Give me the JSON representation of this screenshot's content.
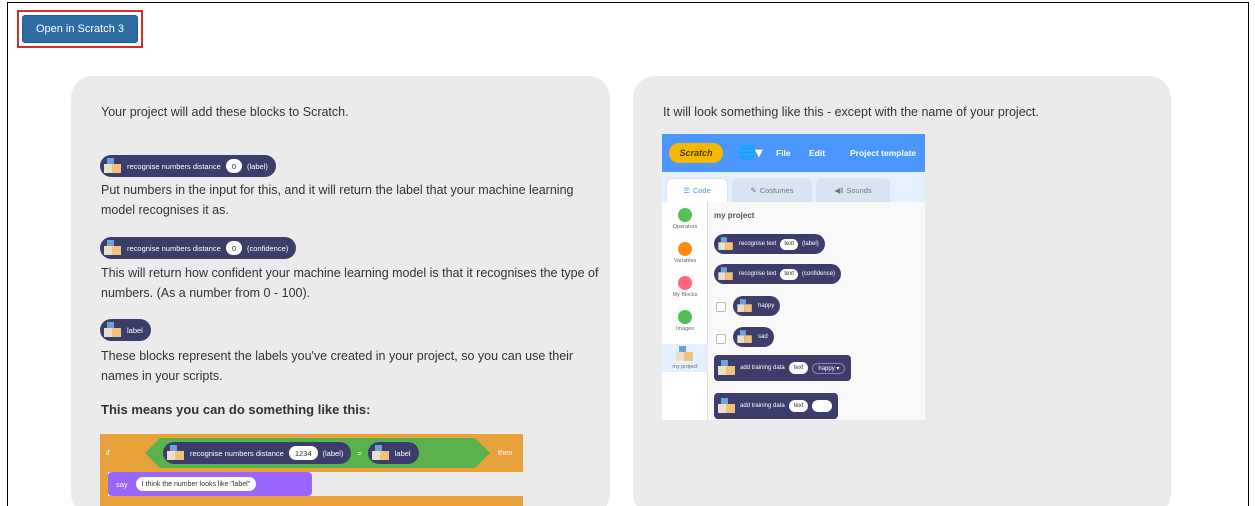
{
  "open_button": {
    "label": "Open in Scratch 3"
  },
  "left_panel": {
    "intro": "Your project will add these blocks to Scratch.",
    "block1": {
      "text": "recognise numbers  distance",
      "value": "0",
      "suffix": "(label)"
    },
    "desc1": "Put numbers in the input for this, and it will return the label that your machine learning model recognises it as.",
    "block2": {
      "text": "recognise numbers  distance",
      "value": "0",
      "suffix": "(confidence)"
    },
    "desc2": "This will return how confident your machine learning model is that it recognises the type of numbers. (As a number from 0 - 100).",
    "block3": {
      "text": "label"
    },
    "desc3": "These blocks represent the labels you've created in your project, so you can use their names in your scripts.",
    "example_heading": "This means you can do something like this:",
    "example": {
      "if_kw": "if",
      "then_kw": "then",
      "block_text": "recognise numbers  distance",
      "block_value": "1234",
      "block_suffix": "(label)",
      "eq": "=",
      "label_text": "label",
      "say_kw": "say",
      "say_value": "I think the number looks like \"label\""
    }
  },
  "right_panel": {
    "intro": "It will look something like this - except with the name of your project.",
    "scratch": {
      "logo": "Scratch",
      "globe": "🌐▾",
      "menu_file": "File",
      "menu_edit": "Edit",
      "project_title": "Project template",
      "tabs": [
        "Code",
        "Costumes",
        "Sounds"
      ],
      "categories": [
        {
          "label": "Operators",
          "color": "#59c059"
        },
        {
          "label": "Variables",
          "color": "#ff8c1a"
        },
        {
          "label": "My Blocks",
          "color": "#ff6680"
        },
        {
          "label": "Images",
          "color": "#4cbf56"
        },
        {
          "label": "my project",
          "color": ""
        }
      ],
      "workspace_title": "my project",
      "blocks": [
        {
          "text": "recognise text",
          "value": "text",
          "suffix": "(label)"
        },
        {
          "text": "recognise text",
          "value": "text",
          "suffix": "(confidence)"
        },
        {
          "text": "happy"
        },
        {
          "text": "sad"
        },
        {
          "text": "add training data",
          "value": "text",
          "dropdown": "happy ▾"
        },
        {
          "text": "add training data",
          "value": "text"
        }
      ]
    }
  }
}
